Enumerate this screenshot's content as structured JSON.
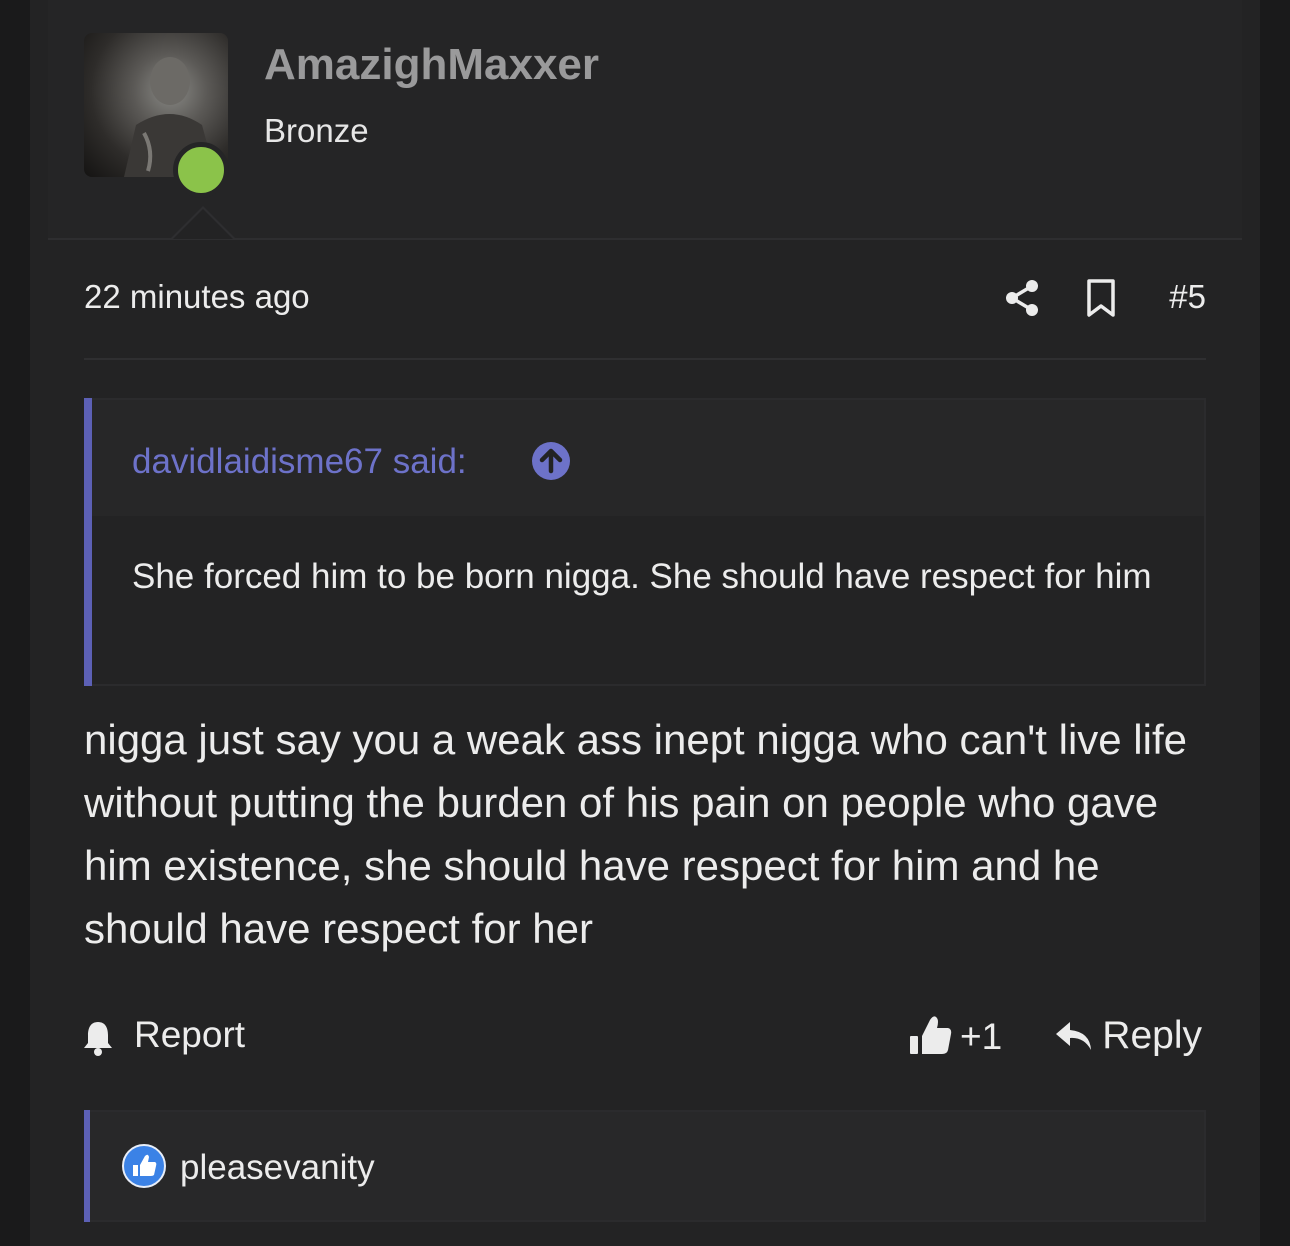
{
  "post": {
    "author": "AmazighMaxxer",
    "rank": "Bronze",
    "timestamp": "22 minutes ago",
    "post_number": "#5",
    "quote": {
      "author_said": "davidlaidisme67 said:",
      "text": "She forced him to be born nigga. She should have respect for him"
    },
    "message": "nigga just say you a weak ass inept nigga who can't live life without putting the burden of his pain on people who gave him existence, she should have respect for him and he should have respect for her",
    "actions": {
      "report_label": "Report",
      "like_count": "+1",
      "reply_label": "Reply"
    },
    "reactions": {
      "users": "pleasevanity"
    }
  },
  "colors": {
    "background": "#232324",
    "accent": "#6d72c9",
    "online_status": "#8bc34a",
    "reaction_like": "#3b82e6"
  },
  "icons": [
    "share-icon",
    "bookmark-icon",
    "arrow-up-icon",
    "bell-icon",
    "thumbs-up-icon",
    "reply-icon"
  ]
}
